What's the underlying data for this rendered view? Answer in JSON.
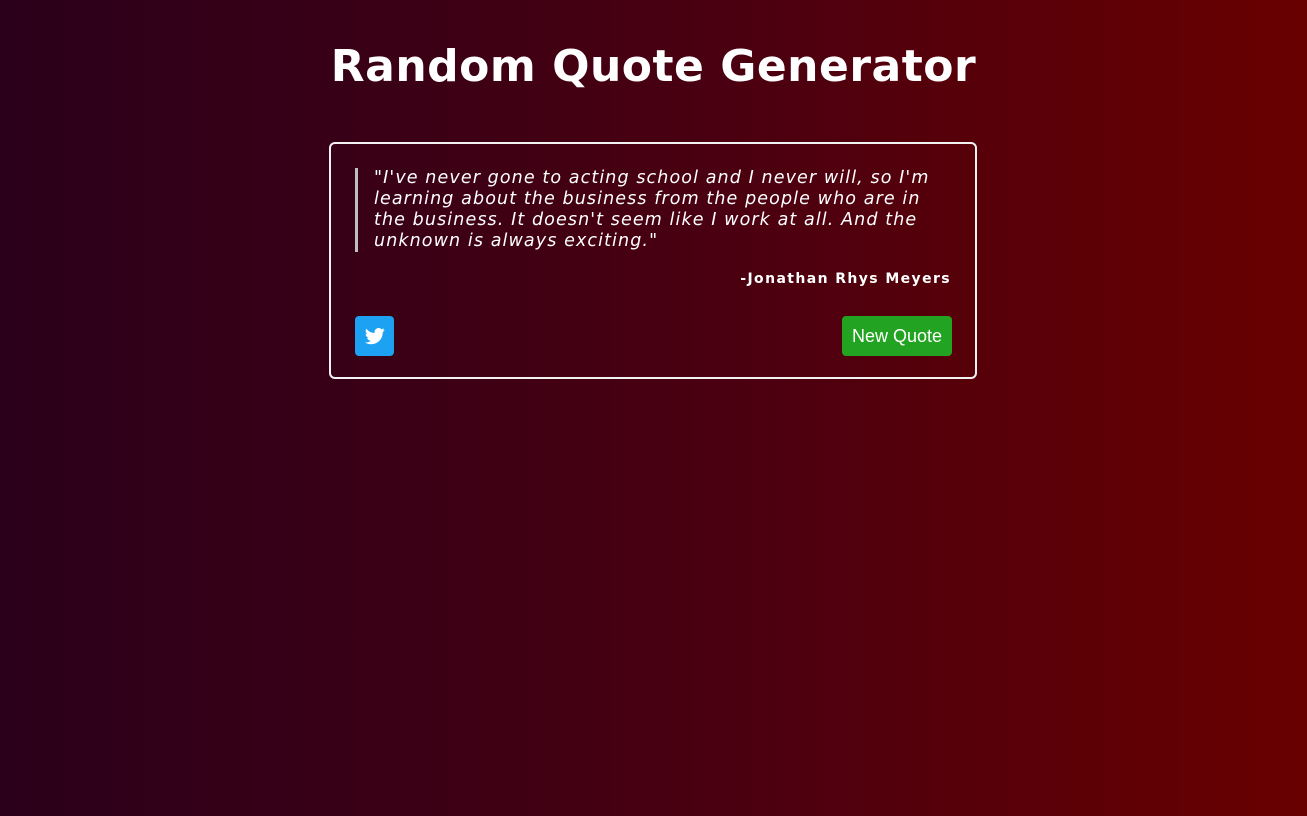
{
  "header": {
    "title": "Random Quote Generator"
  },
  "quote": {
    "text": "\"I've never gone to acting school and I never will, so I'm learning about the business from the people who are in the business. It doesn't seem like I work at all. And the unknown is always exciting.\"",
    "author": "-Jonathan Rhys Meyers"
  },
  "actions": {
    "tweet_icon": "twitter-icon",
    "new_quote_label": "New Quote"
  },
  "colors": {
    "tweet_button": "#1da1f2",
    "new_quote_button": "#22a321",
    "gradient_start": "#2b001b",
    "gradient_end": "#680000"
  }
}
